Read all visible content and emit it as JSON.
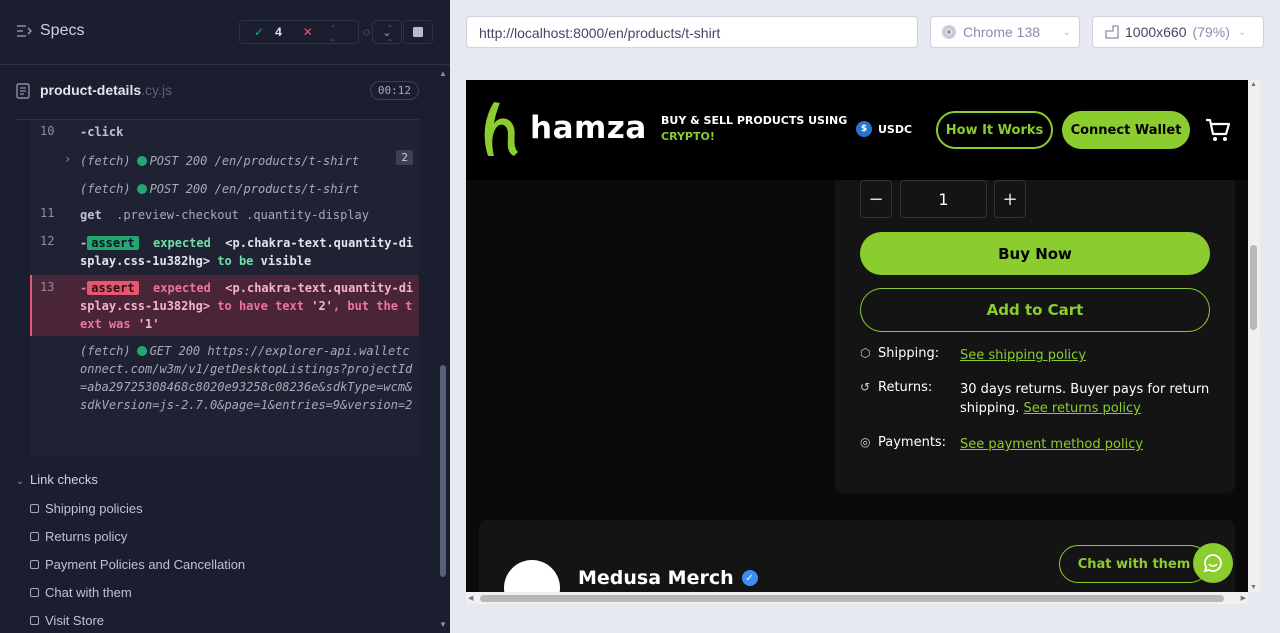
{
  "left": {
    "title": "Specs",
    "stats": {
      "passed": "4",
      "failed": "--",
      "pending": "--"
    },
    "spec": {
      "name": "product-details",
      "ext": ".cy.js",
      "timer": "00:12"
    },
    "commands": [
      {
        "num": "10",
        "method": "-click"
      },
      {
        "label": "(fetch)",
        "req": "POST 200 /en/products/t-shirt",
        "count": "2"
      },
      {
        "label": "(fetch)",
        "req": "POST 200 /en/products/t-shirt"
      },
      {
        "num": "11",
        "method": "get",
        "arg": ".preview-checkout .quantity-display"
      },
      {
        "num": "12",
        "badge": "assert",
        "w1": "expected",
        "sel": "<p.chakra-text.quantity-display.css-1u382hg>",
        "w2": "to be",
        "w3": "visible"
      },
      {
        "num": "13",
        "badge": "assert",
        "w1": "expected",
        "sel": "<p.chakra-text.quantity-display.css-1u382hg>",
        "w2": "to have text",
        "v1": "'2'",
        "w3": ", but the text was",
        "v2": "'1'"
      },
      {
        "label": "(fetch)",
        "req": "GET 200 https://explorer-api.walletconnect.com/w3m/v1/getDesktopListings?projectId=aba29725308468c8020e93258c08236e&sdkType=wcm&sdkVersion=js-2.7.0&page=1&entries=9&version=2"
      }
    ],
    "suite": "Link checks",
    "tests": [
      "Shipping policies",
      "Returns policy",
      "Payment Policies and Cancellation",
      "Chat with them",
      "Visit Store"
    ]
  },
  "toolbar": {
    "url": "http://localhost:8000/en/products/t-shirt",
    "browser": "Chrome 138",
    "viewport": "1000x660",
    "zoom": "(79%)"
  },
  "app": {
    "logo": "hamza",
    "tagline_1": "BUY & SELL PRODUCTS USING",
    "tagline_2": "CRYPTO!",
    "currency": "USDC",
    "how_it_works": "How It Works",
    "connect_wallet": "Connect Wallet",
    "quantity": "1",
    "buy_now": "Buy Now",
    "add_to_cart": "Add to Cart",
    "shipping_label": "Shipping:",
    "shipping_link": "See shipping policy",
    "returns_label": "Returns:",
    "returns_text": "30 days returns. Buyer pays for return shipping.",
    "returns_link": "See returns policy",
    "payments_label": "Payments:",
    "payments_link": "See payment method policy",
    "store_name": "Medusa Merch",
    "chat_button": "Chat with them"
  },
  "colors": {
    "accent": "#8bcc2f",
    "pass": "#1fa971",
    "fail": "#e45770",
    "panel": "#1b1e2e"
  }
}
